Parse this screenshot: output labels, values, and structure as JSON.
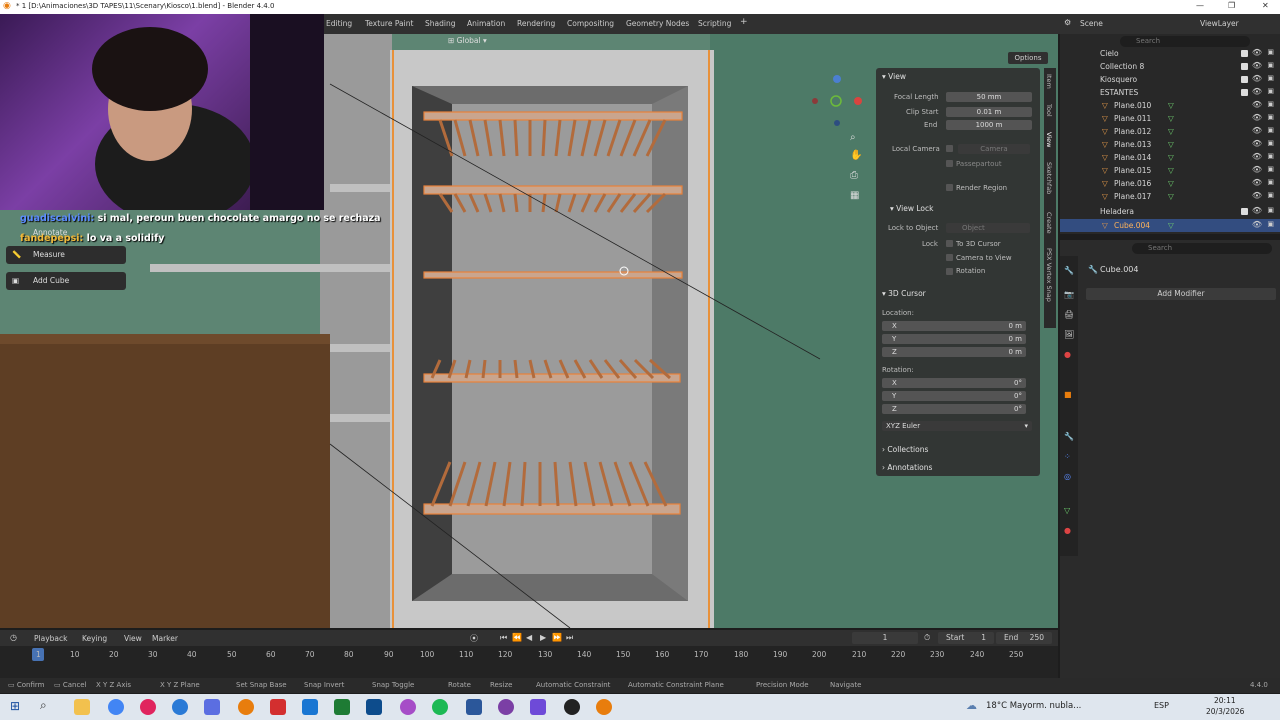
{
  "window": {
    "title": "* 1 [D:\\Animaciones\\3D TAPES\\11\\Scenary\\Kiosco\\1.blend] - Blender 4.4.0"
  },
  "workspaces": [
    "Editing",
    "Texture Paint",
    "Shading",
    "Animation",
    "Rendering",
    "Compositing",
    "Geometry Nodes",
    "Scripting"
  ],
  "scene_label": "Scene",
  "viewlayer_label": "ViewLayer",
  "viewport": {
    "transform_orientation": "Global",
    "options_label": "Options"
  },
  "chat": {
    "line1_user": "guadiscalvini:",
    "line1_text": "si mal, peroun buen chocolate amargo no se rechaza",
    "line2_user": "fandepepsi:",
    "line2_text": "lo va a solidify"
  },
  "tools": {
    "annotate": "Annotate",
    "measure": "Measure",
    "add_cube": "Add Cube"
  },
  "npanel": {
    "view_header": "View",
    "focal_length_label": "Focal Length",
    "focal_length": "50 mm",
    "clip_start_label": "Clip Start",
    "clip_start": "0.01 m",
    "end_label": "End",
    "end": "1000 m",
    "local_camera_label": "Local Camera",
    "camera_placeholder": "Camera",
    "passepartout": "Passepartout",
    "render_region": "Render Region",
    "view_lock_header": "View Lock",
    "lock_to_object_label": "Lock to Object",
    "object_placeholder": "Object",
    "lock_label": "Lock",
    "to_3d_cursor": "To 3D Cursor",
    "camera_to_view": "Camera to View",
    "rotation_lock": "Rotation",
    "cursor_header": "3D Cursor",
    "location_label": "Location:",
    "loc_x_label": "X",
    "loc_x": "0 m",
    "loc_y_label": "Y",
    "loc_y": "0 m",
    "loc_z_label": "Z",
    "loc_z": "0 m",
    "rotation_label": "Rotation:",
    "rot_x_label": "X",
    "rot_x": "0°",
    "rot_y_label": "Y",
    "rot_y": "0°",
    "rot_z_label": "Z",
    "rot_z": "0°",
    "euler_mode": "XYZ Euler",
    "collections": "Collections",
    "annotations": "Annotations",
    "tabs": [
      "Item",
      "Tool",
      "View",
      "Sketchfab",
      "Create",
      "PSX Vertex Snap"
    ]
  },
  "outliner": {
    "search_placeholder": "Search",
    "rows": [
      {
        "name": "Cielo"
      },
      {
        "name": "Collection 8"
      },
      {
        "name": "Kiosquero"
      },
      {
        "name": "ESTANTES"
      },
      {
        "name": "Plane.010"
      },
      {
        "name": "Plane.011"
      },
      {
        "name": "Plane.012"
      },
      {
        "name": "Plane.013"
      },
      {
        "name": "Plane.014"
      },
      {
        "name": "Plane.015"
      },
      {
        "name": "Plane.016"
      },
      {
        "name": "Plane.017"
      },
      {
        "name": "Heladera"
      },
      {
        "name": "Cube.004"
      }
    ]
  },
  "properties": {
    "search_placeholder": "Search",
    "object_name": "Cube.004",
    "add_modifier": "Add Modifier"
  },
  "timeline": {
    "playback": "Playback",
    "keying": "Keying",
    "view": "View",
    "marker": "Marker",
    "current_frame": "1",
    "start_label": "Start",
    "start": "1",
    "end_label": "End",
    "end": "250",
    "ticks": [
      "1",
      "10",
      "20",
      "30",
      "40",
      "50",
      "60",
      "70",
      "80",
      "90",
      "100",
      "110",
      "120",
      "130",
      "140",
      "150",
      "160",
      "170",
      "180",
      "190",
      "200",
      "210",
      "220",
      "230",
      "240",
      "250"
    ]
  },
  "statusbar": {
    "items": [
      "Confirm",
      "Cancel",
      "X Y Z Axis",
      "X Y Z Plane",
      "Set Snap Base",
      "Snap Invert",
      "Snap Toggle",
      "Rotate",
      "Resize",
      "Automatic Constraint",
      "Automatic Constraint Plane",
      "Precision Mode",
      "Navigate"
    ],
    "version": "4.4.0"
  },
  "taskbar": {
    "weather": "18°C  Mayorm. nubla...",
    "lang": "ESP",
    "time": "20:11",
    "date": "20/3/2026"
  }
}
